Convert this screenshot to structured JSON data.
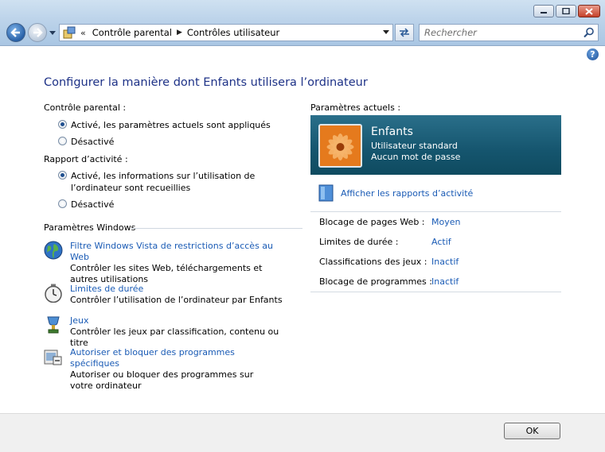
{
  "address": {
    "chevron": "«",
    "crumbs": [
      "Contrôle parental",
      "Contrôles utilisateur"
    ]
  },
  "search": {
    "placeholder": "Rechercher"
  },
  "help_label": "?",
  "heading": "Configurer la manière dont Enfants utilisera l’ordinateur",
  "parental_control": {
    "label": "Contrôle parental :",
    "options": [
      {
        "label": "Activé, les paramètres actuels sont appliqués",
        "selected": true
      },
      {
        "label": "Désactivé",
        "selected": false
      }
    ]
  },
  "activity_report": {
    "label": "Rapport d’activité :",
    "options": [
      {
        "label": "Activé, les informations sur l’utilisation de l’ordinateur sont recueillies",
        "selected": true
      },
      {
        "label": "Désactivé",
        "selected": false
      }
    ]
  },
  "windows_settings": {
    "label": "Paramètres Windows",
    "items": [
      {
        "title": "Filtre Windows Vista de restrictions d’accès au Web",
        "desc": "Contrôler les sites Web, téléchargements et autres utilisations",
        "icon": "globe-icon"
      },
      {
        "title": "Limites de durée",
        "desc": "Contrôler l’utilisation de l’ordinateur par Enfants",
        "icon": "clock-icon"
      },
      {
        "title": "Jeux",
        "desc": "Contrôler les jeux par classification, contenu ou titre",
        "icon": "games-icon"
      },
      {
        "title": "Autoriser et bloquer des programmes spécifiques",
        "desc": "Autoriser ou bloquer des programmes sur votre ordinateur",
        "icon": "programs-icon"
      }
    ]
  },
  "current": {
    "label": "Paramètres actuels :",
    "user_name": "Enfants",
    "account_type": "Utilisateur standard",
    "password": "Aucun mot de passe",
    "reports_link": "Afficher les rapports d’activité",
    "settings": [
      {
        "key": "Blocage de pages Web :",
        "value": "Moyen"
      },
      {
        "key": "Limites de durée :",
        "value": "Actif"
      },
      {
        "key": "Classifications des jeux :",
        "value": "Inactif"
      },
      {
        "key": "Blocage de programmes :",
        "value": "Inactif"
      }
    ]
  },
  "ok_label": "OK",
  "colors": {
    "title": "#1e3287",
    "link": "#1a5bb5",
    "panel": "#15556e"
  }
}
